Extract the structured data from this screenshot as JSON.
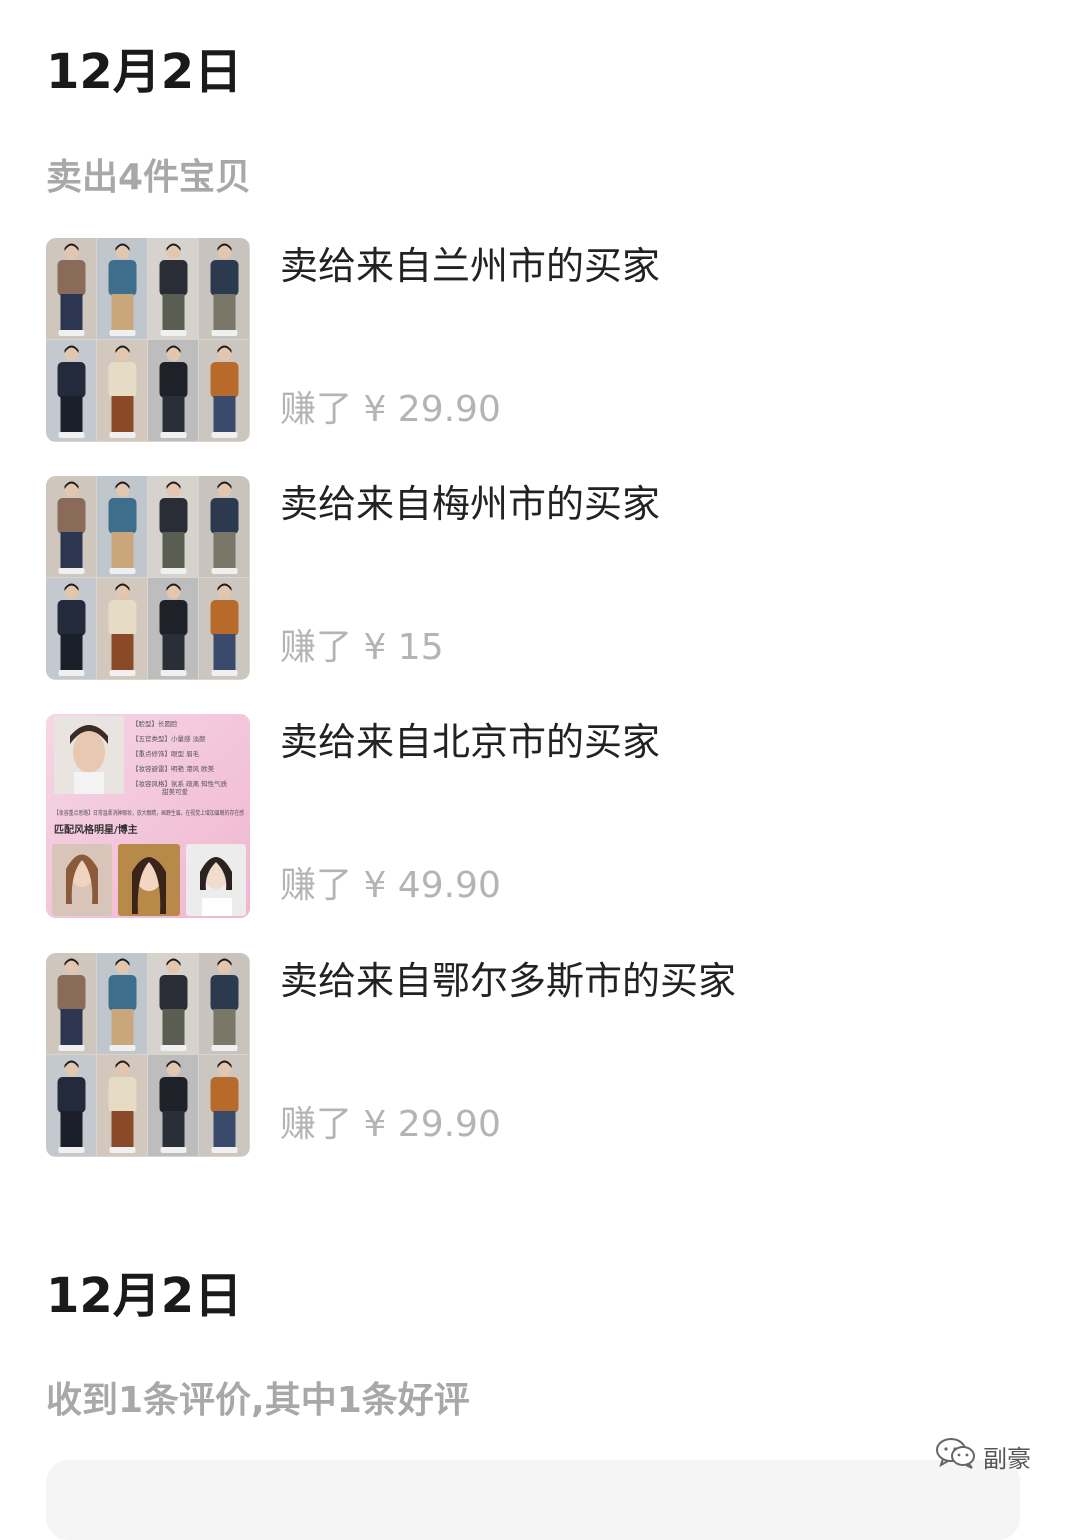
{
  "sections": [
    {
      "date": "12月2日",
      "summary": "卖出4件宝贝",
      "sales": [
        {
          "title": "卖给来自兰州市的买家",
          "earned": "赚了 ¥ 29.90",
          "thumb_icon": "outfit-grid-thumbnail"
        },
        {
          "title": "卖给来自梅州市的买家",
          "earned": "赚了 ¥ 15",
          "thumb_icon": "outfit-grid-thumbnail"
        },
        {
          "title": "卖给来自北京市的买家",
          "earned": "赚了 ¥ 49.90",
          "thumb_icon": "makeup-analysis-thumbnail"
        },
        {
          "title": "卖给来自鄂尔多斯市的买家",
          "earned": "赚了 ¥ 29.90",
          "thumb_icon": "outfit-grid-thumbnail"
        }
      ]
    },
    {
      "date": "12月2日",
      "summary": "收到1条评价,其中1条好评"
    }
  ],
  "makeup_thumb": {
    "lines": [
      "【脸型】长圆脸",
      "【五官类型】小量感 淡颜",
      "【重点修饰】眼型 眉毛",
      "【妆容避雷】明艳 港风 欧美",
      "【妆容风格】氛系 疏离 知性气质",
      "甜美可爱"
    ],
    "tip": "【妆容重点思路】日常温柔消肿眼妆，放大眼睛，画野生眉，在视觉上增加眉眼的存在感",
    "match_label": "匹配风格明星/博主"
  },
  "watermark": {
    "icon": "wechat-icon",
    "label": "副豪"
  },
  "colors": {
    "summary_gray": "#a8a8a8",
    "earn_gray": "#b4b4b4",
    "title": "#222222"
  }
}
